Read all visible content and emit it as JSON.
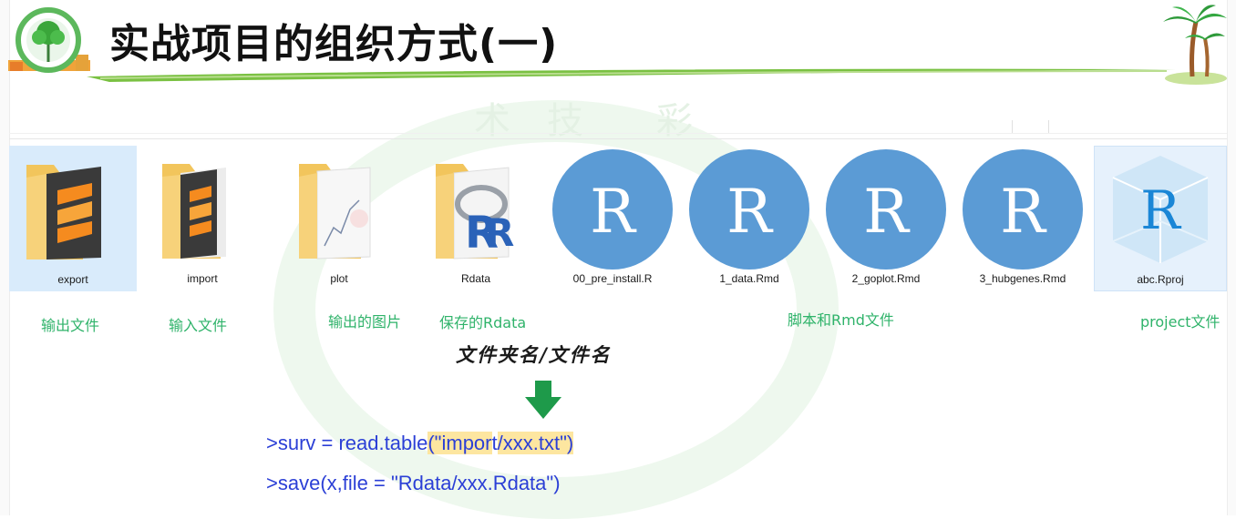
{
  "slide": {
    "title": "实战项目的组织方式(一)",
    "watermark_chars": [
      "术",
      "技",
      "彩"
    ]
  },
  "files": [
    {
      "label": "export",
      "kind": "folder-sublime",
      "icon": "folder-sublime-icon",
      "selected": true
    },
    {
      "label": "import",
      "kind": "folder-sublime",
      "icon": "folder-sublime-icon"
    },
    {
      "label": "plot",
      "kind": "folder-plot",
      "icon": "folder-plot-icon"
    },
    {
      "label": "Rdata",
      "kind": "folder-r",
      "icon": "folder-r-icon"
    },
    {
      "label": "00_pre_install.R",
      "kind": "r-script",
      "icon": "r-circle-icon"
    },
    {
      "label": "1_data.Rmd",
      "kind": "r-script",
      "icon": "r-circle-icon"
    },
    {
      "label": "2_goplot.Rmd",
      "kind": "r-script",
      "icon": "r-circle-icon"
    },
    {
      "label": "3_hubgenes.Rmd",
      "kind": "r-script",
      "icon": "r-circle-icon"
    },
    {
      "label": "abc.Rproj",
      "kind": "rproj",
      "icon": "rproj-cube-icon",
      "selected": true
    }
  ],
  "captions": {
    "export": "输出文件",
    "import": "输入文件",
    "plot": "输出的图片",
    "rdata": "保存的Rdata",
    "scripts": "脚本和Rmd文件",
    "project": "project文件"
  },
  "annotation": {
    "handwritten": "文件夹名/文件名"
  },
  "code": {
    "line1_a": ">surv = read.table",
    "line1_b": "(\"impor",
    "line1_c": "t",
    "line1_d": "/xxx.txt\")",
    "line2": ">save(x,file = \"Rdata/xxx.Rdata\")"
  },
  "colors": {
    "caption_green": "#2fb36a",
    "code_blue": "#2b3fd6",
    "highlight": "#fde6a0",
    "r_circle": "#5b9bd5",
    "arrow_green": "#1e9a4a",
    "selection": "#d9ebfb"
  }
}
